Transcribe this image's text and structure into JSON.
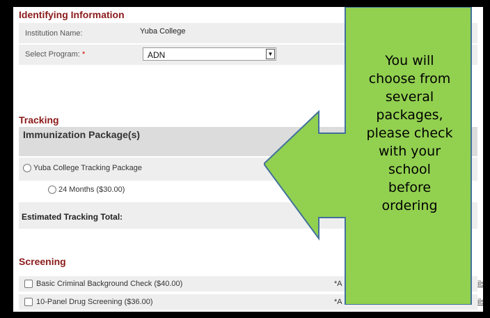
{
  "identifying": {
    "title": "Identifying Information",
    "institution_label": "Institution Name:",
    "institution_value": "Yuba College",
    "program_label": "Select Program:",
    "required_mark": "*",
    "program_value": "ADN"
  },
  "tracking": {
    "title": "Tracking",
    "package_header": "Immunization Package(s)",
    "package_option": "Yuba College Tracking Package",
    "duration_option": "24 Months ($30.00)",
    "total_label": "Estimated Tracking Total:"
  },
  "screening": {
    "title": "Screening",
    "items": [
      {
        "label": "Basic Criminal Background Check ($40.00)",
        "note": "*A",
        "link": "ils"
      },
      {
        "label": "10-Panel Drug Screening ($36.00)",
        "note": "*A",
        "link": "ils"
      }
    ]
  },
  "callout": {
    "lines": [
      "You will",
      "choose from",
      "several",
      "packages,",
      "please check",
      "with your",
      "school",
      "before",
      "ordering"
    ],
    "fill_color": "#92d050",
    "border_color": "#41719c"
  }
}
